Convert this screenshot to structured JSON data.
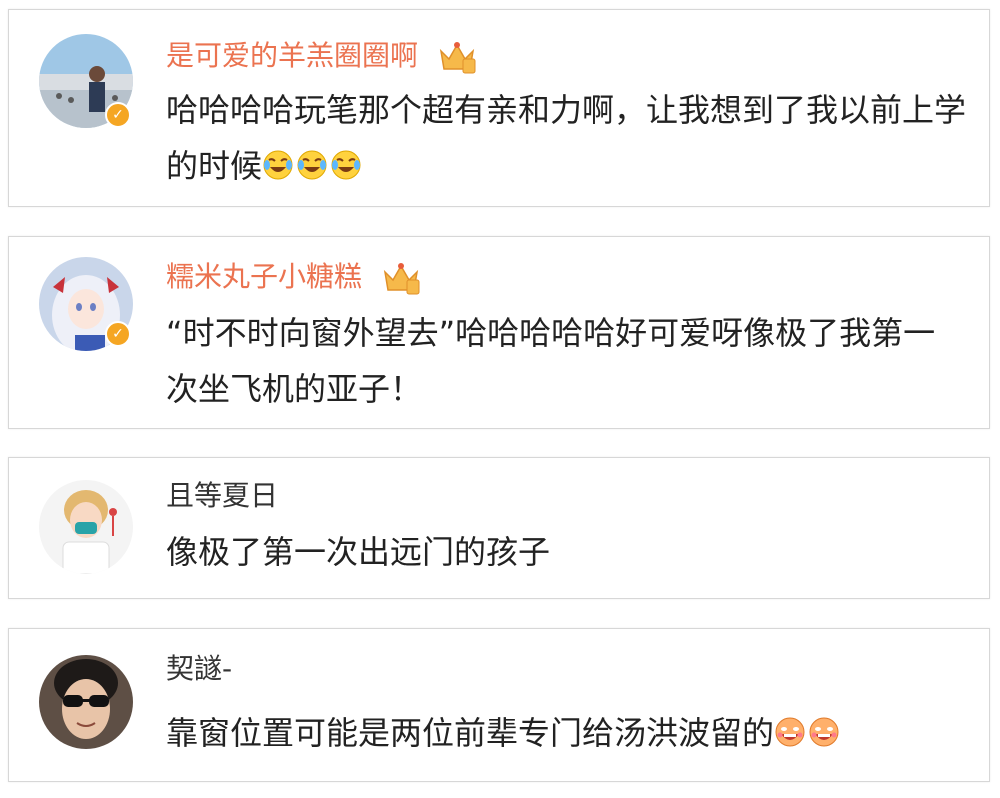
{
  "colors": {
    "vip_name": "#eb7350",
    "plain_name": "#333333",
    "verified_badge": "#f5a623",
    "comment_text": "#222222"
  },
  "comments": [
    {
      "username": "是可爱的羊羔圈圈啊",
      "user_style": "vip",
      "verified": true,
      "badge": "crown-icon",
      "text": "哈哈哈哈玩笔那个超有亲和力啊，让我想到了我以前上学的时候",
      "emojis": [
        "laugh-cry-emoji",
        "laugh-cry-emoji",
        "laugh-cry-emoji"
      ]
    },
    {
      "username": "糯米丸子小糖糕",
      "user_style": "vip",
      "verified": true,
      "badge": "crown-icon",
      "text": "“时不时向窗外望去”哈哈哈哈哈好可爱呀像极了我第一次坐飞机的亚子！",
      "emojis": []
    },
    {
      "username": "且等夏日",
      "user_style": "plain",
      "verified": false,
      "text": "像极了第一次出远门的孩子",
      "emojis": []
    },
    {
      "username": "契譢-",
      "user_style": "plain",
      "verified": false,
      "text": "靠窗位置可能是两位前辈专门给汤洪波留的",
      "emojis": [
        "grin-emoji",
        "grin-emoji"
      ]
    }
  ]
}
